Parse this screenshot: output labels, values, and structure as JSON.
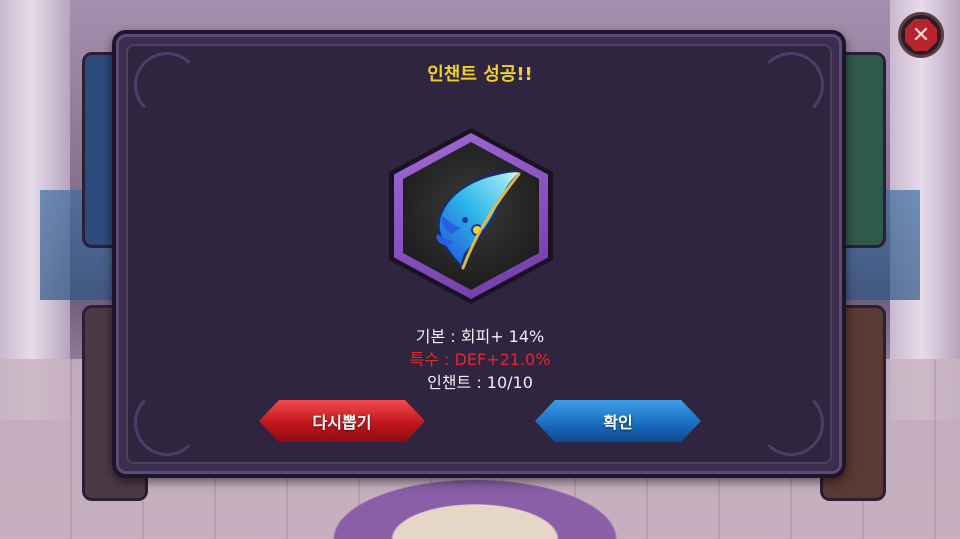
{
  "dialog": {
    "title": "인챈트 성공!!",
    "item_icon": "blue-feather-icon",
    "stats": {
      "basic": "기본 : 회피+ 14%",
      "special": "특수 : DEF+21.0%",
      "enchant": "인챈트 : 10/10"
    },
    "buttons": {
      "redraw": "다시뽑기",
      "confirm": "확인"
    }
  },
  "close_icon": "close-icon",
  "colors": {
    "title": "#f2d02b",
    "special_stat": "#e5272e",
    "hex_frame": "#8a52c4",
    "redraw_button": "#c2161d",
    "confirm_button": "#1a6fc2"
  }
}
